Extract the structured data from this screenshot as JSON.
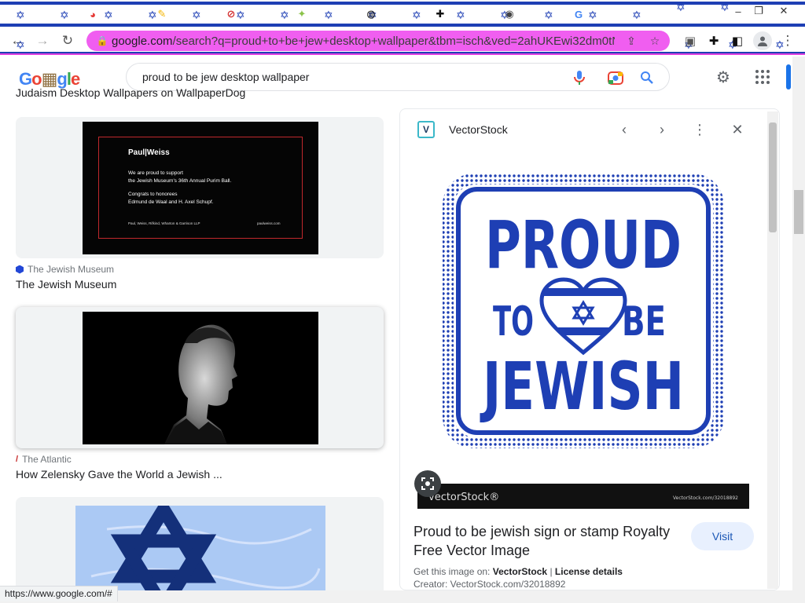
{
  "browser": {
    "url_host": "google.com",
    "url_rest": "/search?q=proud+to+be+jew+desktop+wallpaper&tbm=isch&ved=2ahUKEwi32dm0tNn...",
    "tab_icons": [
      "chrome-icon",
      "feather-icon",
      "block-icon",
      "star-bolt-icon",
      "globe-icon",
      "puzzle-icon",
      "chrome-icon",
      "google-icon"
    ],
    "window_buttons": [
      "–",
      "❐",
      "✕"
    ]
  },
  "header": {
    "logo_text": "Google",
    "search_query": "proud to be jew desktop wallpaper"
  },
  "results": {
    "cutoff_title": "Judaism Desktop Wallpapers on WallpaperDog",
    "items": [
      {
        "source": "The Jewish Museum",
        "title": "The Jewish Museum",
        "image": {
          "brand": "Paul|Weiss",
          "line1": "We are proud to support",
          "line2": "the Jewish Museum's 36th Annual Purim Ball.",
          "line3": "Congrats to honorees",
          "line4": "Edmund de Waal and H. Axel Schupf.",
          "footer_left": "Paul, Weiss, Rifkind, Wharton & Garrison LLP",
          "footer_right": "paulweiss.com"
        }
      },
      {
        "source": "The Atlantic",
        "title": "How Zelensky Gave the World a Jewish ..."
      },
      {
        "source": "",
        "title": ""
      }
    ]
  },
  "panel": {
    "site_name": "VectorStock",
    "image_text": {
      "proud": "PROUD",
      "to": "TO",
      "be": "BE",
      "jewish": "JEWISH",
      "watermark": "vectorStock®",
      "watermark_right": "VectorStock.com/32018892"
    },
    "title": "Proud to be jewish sign or stamp Royalty Free Vector Image",
    "visit_label": "Visit",
    "get_this_prefix": "Get this image on:",
    "get_this_site": "VectorStock",
    "license_label": "License details",
    "creator": "Creator: VectorStock.com/32018892"
  },
  "status_url": "https://www.google.com/#",
  "colors": {
    "flag_blue": "#1e3fb4",
    "omnibox_pink": "#f05ef0",
    "stamp_blue": "#1e3fb4",
    "google_blue": "#1a73e8"
  }
}
